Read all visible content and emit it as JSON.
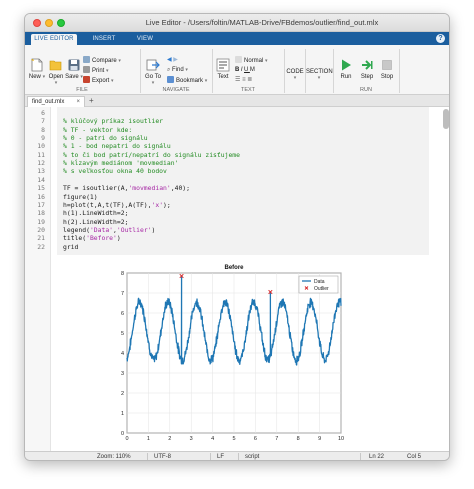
{
  "window": {
    "title": "Live Editor - /Users/foltin/MATLAB-Drive/FBdemos/outlier/find_out.mlx"
  },
  "ribbon_tabs": [
    "LIVE EDITOR",
    "INSERT",
    "VIEW"
  ],
  "ribbon": {
    "file": {
      "new": "New",
      "open": "Open",
      "save": "Save",
      "compare": "Compare",
      "print": "Print",
      "export": "Export",
      "label": "FILE"
    },
    "navigate": {
      "goto": "Go To",
      "find": "Find",
      "bookmark": "Bookmark",
      "label": "NAVIGATE"
    },
    "text": {
      "text": "Text",
      "style": "Normal",
      "label": "TEXT"
    },
    "code": {
      "label": "CODE"
    },
    "section": {
      "label": "SECTION"
    },
    "run": {
      "run": "Run",
      "step": "Step",
      "stop": "Stop",
      "label": "RUN"
    }
  },
  "doc_tab": {
    "name": "find_out.mlx",
    "close": "×",
    "add": "+"
  },
  "editor": {
    "line_numbers": [
      "6",
      "7",
      "8",
      "9",
      "10",
      "11",
      "12",
      "13",
      "14",
      "15",
      "16",
      "17",
      "18",
      "19",
      "20",
      "21",
      "22"
    ],
    "lines": [
      {
        "n": "6",
        "segments": []
      },
      {
        "n": "7",
        "segments": [
          {
            "t": "% klúčový príkaz isoutlier",
            "c": "cm"
          }
        ]
      },
      {
        "n": "8",
        "segments": [
          {
            "t": "% TF - vektor kde:",
            "c": "cm"
          }
        ]
      },
      {
        "n": "9",
        "segments": [
          {
            "t": "% 0 - patri do signálu",
            "c": "cm"
          }
        ]
      },
      {
        "n": "10",
        "segments": [
          {
            "t": "% 1 - bod nepatri do signálu",
            "c": "cm"
          }
        ]
      },
      {
        "n": "11",
        "segments": [
          {
            "t": "% to či bod patrí/nepatrí do signálu zisťujeme",
            "c": "cm"
          }
        ]
      },
      {
        "n": "12",
        "segments": [
          {
            "t": "% kĺzavým mediánom 'movmedian'",
            "c": "cm"
          }
        ]
      },
      {
        "n": "13",
        "segments": [
          {
            "t": "% s veľkosťou okna 40 bodov",
            "c": "cm"
          }
        ]
      },
      {
        "n": "14",
        "segments": []
      },
      {
        "n": "15",
        "segments": [
          {
            "t": "TF = isoutlier(A,",
            "c": ""
          },
          {
            "t": "'movmedian'",
            "c": "st"
          },
          {
            "t": ",40);",
            "c": ""
          }
        ]
      },
      {
        "n": "16",
        "segments": [
          {
            "t": "figure(1)",
            "c": ""
          }
        ]
      },
      {
        "n": "17",
        "segments": [
          {
            "t": "h=plot(t,A,t(TF),A(TF),",
            "c": ""
          },
          {
            "t": "'x'",
            "c": "st"
          },
          {
            "t": ");",
            "c": ""
          }
        ]
      },
      {
        "n": "18",
        "segments": [
          {
            "t": "h(1).LineWidth=2;",
            "c": ""
          }
        ]
      },
      {
        "n": "19",
        "segments": [
          {
            "t": "h(2).LineWidth=2;",
            "c": ""
          }
        ]
      },
      {
        "n": "20",
        "segments": [
          {
            "t": "legend(",
            "c": ""
          },
          {
            "t": "'Data'",
            "c": "st"
          },
          {
            "t": ",",
            "c": ""
          },
          {
            "t": "'Outlier'",
            "c": "st"
          },
          {
            "t": ")",
            "c": ""
          }
        ]
      },
      {
        "n": "21",
        "segments": [
          {
            "t": "title(",
            "c": ""
          },
          {
            "t": "'Before'",
            "c": "st"
          },
          {
            "t": ")",
            "c": ""
          }
        ]
      },
      {
        "n": "22",
        "segments": [
          {
            "t": "grid",
            "c": ""
          }
        ]
      }
    ]
  },
  "status": {
    "zoom": "Zoom: 110%",
    "encoding": "UTF-8",
    "eol": "LF",
    "type": "script",
    "ln": "Ln   22",
    "col": "Col   5"
  },
  "colors": {
    "ribbon_blue": "#1b5e9e",
    "data_line": "#1f77b4",
    "outlier": "#d62728",
    "comment": "#228b22",
    "string": "#a626a4"
  },
  "chart_data": {
    "type": "line",
    "title": "Before",
    "xlim": [
      0,
      10
    ],
    "ylim": [
      0,
      8
    ],
    "xticks": [
      0,
      1,
      2,
      3,
      4,
      5,
      6,
      7,
      8,
      9,
      10
    ],
    "yticks": [
      0,
      1,
      2,
      3,
      4,
      5,
      6,
      7,
      8
    ],
    "grid": true,
    "legend_position": "top-right",
    "series": [
      {
        "name": "Data",
        "kind": "noisy-sine",
        "offset": 5.1,
        "amplitude": 1.45,
        "periods": 7.5,
        "noise": 0.18,
        "x_from": 0,
        "x_to": 10,
        "spikes": [
          {
            "x": 2.55,
            "y": 7.85
          },
          {
            "x": 6.7,
            "y": 7.05
          }
        ]
      },
      {
        "name": "Outlier",
        "marker": "x",
        "points": [
          {
            "x": 2.55,
            "y": 7.85
          },
          {
            "x": 6.7,
            "y": 7.05
          }
        ]
      }
    ]
  }
}
